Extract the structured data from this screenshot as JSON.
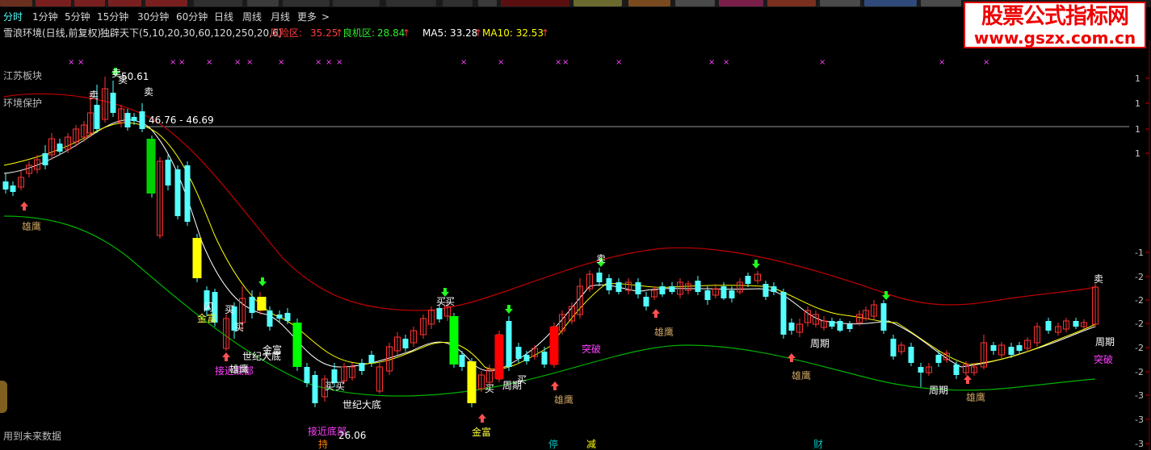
{
  "periods": [
    "分时",
    "1分钟",
    "5分钟",
    "15分钟",
    "30分钟",
    "60分钟",
    "日线",
    "周线",
    "月线",
    "更多"
  ],
  "more_arrow": ">",
  "info": {
    "title": "雪浪环境(日线,前复权)",
    "indicator": "独辟天下(5,10,20,30,60,120,250,20,6)",
    "risk_label": "风险区:",
    "risk_value": "35.25",
    "risk_arrow": "↑",
    "chance_label": "良机区:",
    "chance_value": "28.84",
    "chance_arrow": "↑",
    "ma5": "MA5: 33.28",
    "ma5_arrow": "↑",
    "ma10": "MA10: 32.53",
    "ma10_arrow": "↑"
  },
  "watermark": {
    "title": "股票公式指标网",
    "url": "www.gszx.com.cn"
  },
  "overlay": {
    "sector": "江苏板块",
    "env": "环境保护",
    "future": "用到未来数据",
    "hi_price": "50.61",
    "range": "46.76 - 46.69",
    "lo_price": "26.06"
  },
  "colors": {
    "up": "#ff3232",
    "down": "#54ffff",
    "ma5": "#ffffff",
    "ma10": "#ffff00",
    "risk": "#c00000",
    "chance": "#00c000"
  },
  "signals": [
    {
      "t": "雄鹰",
      "c": "#c8a060"
    },
    {
      "t": "金富",
      "c": "#ffff40"
    },
    {
      "t": "接近底部",
      "c": "#ff40ff"
    },
    {
      "t": "世纪大底",
      "c": "#ffffff"
    },
    {
      "t": "接近底部",
      "c": "#ff40ff"
    },
    {
      "t": "世纪大底",
      "c": "#ffffff"
    },
    {
      "t": "金富",
      "c": "#ffff40"
    },
    {
      "t": "突破",
      "c": "#ff40ff"
    },
    {
      "t": "雄鹰",
      "c": "#c8a060"
    },
    {
      "t": "雄鹰",
      "c": "#c8a060"
    },
    {
      "t": "雄鹰",
      "c": "#c8a060"
    },
    {
      "t": "突破",
      "c": "#ff40ff"
    },
    {
      "t": "雄鹰",
      "c": "#c8a060"
    },
    {
      "t": "买",
      "c": "#ffffff"
    },
    {
      "t": "卖",
      "c": "#ffffff"
    },
    {
      "t": "持",
      "c": "#ff8000"
    },
    {
      "t": "停",
      "c": "#00c0c0"
    },
    {
      "t": "减",
      "c": "#ffff00"
    },
    {
      "t": "财",
      "c": "#00c0c0"
    }
  ],
  "y_ticks": [
    "1",
    "1",
    "1",
    "1",
    "-1",
    "-2",
    "-2",
    "-2",
    "-2",
    "-2",
    "-3",
    "-3",
    "-3"
  ],
  "chart_data": {
    "type": "candlestick",
    "title": "雪浪环境(日线,前复权)",
    "series_summary": [
      {
        "name": "MA5",
        "last": 33.28
      },
      {
        "name": "MA10",
        "last": 32.53
      },
      {
        "name": "风险区",
        "last": 35.25
      },
      {
        "name": "良机区",
        "last": 28.84
      }
    ],
    "annotations": {
      "high": 50.61,
      "low": 26.06,
      "range": [
        46.76,
        46.69
      ]
    }
  }
}
